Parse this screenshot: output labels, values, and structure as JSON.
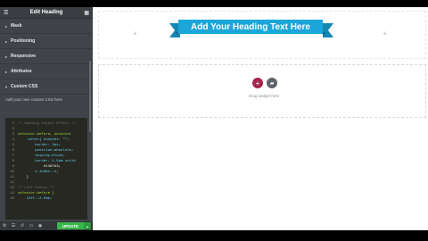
{
  "panel": {
    "title": "Edit Heading",
    "sections": [
      {
        "label": "Mask"
      },
      {
        "label": "Positioning"
      },
      {
        "label": "Responsive"
      },
      {
        "label": "Attributes"
      },
      {
        "label": "Custom CSS"
      }
    ],
    "css_hint": "Add your own custom CSS here",
    "line_numbers": [
      "1",
      "2",
      "3",
      "4",
      "5",
      "6",
      "7",
      "8",
      "9",
      "10",
      "11",
      "12",
      "13",
      "14",
      "15"
    ],
    "code_lines": [
      "/* Heading Ribbon Effect */",
      "",
      "selector:before, selector",
      "    :after{ content: \"\";",
      "        border: 2px;",
      "        position:absolute;",
      "        display:block;",
      "        border: 1.5em solid",
      "            #1487b3;",
      "        z-index:-1;",
      "    }",
      "",
      "/* Left Ribbon */",
      "selector:before {",
      "    left:-2.5em;"
    ],
    "footer": {
      "update_label": "UPDATE"
    }
  },
  "canvas": {
    "heading_text": "Add Your Heading Text Here",
    "drag_text": "Drag widget here"
  },
  "colors": {
    "ribbon": "#1ba6d9",
    "add_button": "#a4254d",
    "update_button": "#39b54a",
    "panel_bg": "#404349"
  },
  "icons": {
    "menu": "hamburger-icon",
    "apps": "grid-icon",
    "add": "plus-icon",
    "template": "folder-icon"
  }
}
